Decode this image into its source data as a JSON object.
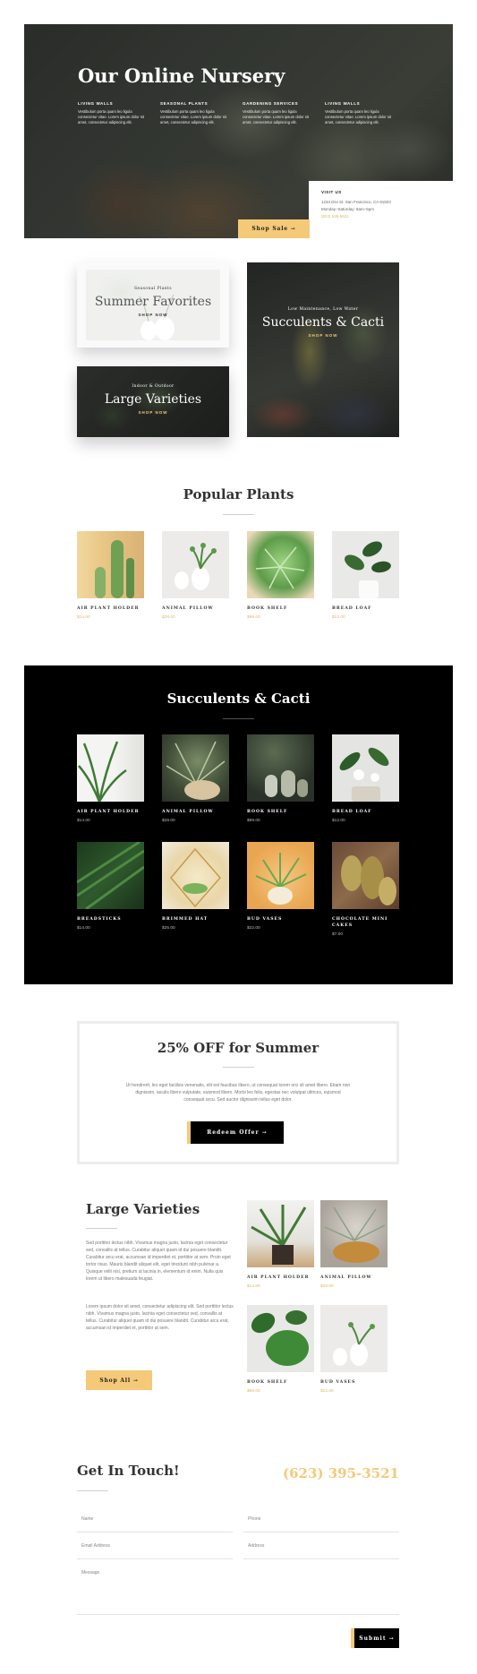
{
  "hero": {
    "title": "Our Online Nursery",
    "columns": [
      {
        "heading": "LIVING WALLS",
        "text": "Vestibulum porta quam leo ligula consectetur vitae. Lorem ipsum dolor sit amet, consectetur adipiscing elit."
      },
      {
        "heading": "SEASONAL PLANTS",
        "text": "Vestibulum porta quam leo ligula consectetur vitae. Lorem ipsum dolor sit amet, consectetur adipiscing elit."
      },
      {
        "heading": "GARDENING SERVICES",
        "text": "Vestibulum porta quam leo ligula consectetur vitae. Lorem ipsum dolor sit amet, consectetur adipiscing elit."
      },
      {
        "heading": "LIVING WALLS",
        "text": "Vestibulum porta quam leo ligula consectetur vitae. Lorem ipsum dolor sit amet, consectetur adipiscing elit."
      }
    ],
    "visit": {
      "heading": "VISIT US",
      "address": "1234 Divi St. San Francisco, CA 91823",
      "hours": "Monday–Saturday: 8am–5pm",
      "phone": "(623) 535-5621"
    },
    "button": "Shop Sale →"
  },
  "categories": {
    "summer": {
      "kicker": "Seasonal Plants",
      "name": "Summer Favorites",
      "cta": "SHOP NOW"
    },
    "large": {
      "kicker": "Indoor & Outdoor",
      "name": "Large Varieties",
      "cta": "SHOP NOW"
    },
    "succulents": {
      "kicker": "Low Maintenance, Low Water",
      "name": "Succulents & Cacti",
      "cta": "SHOP NOW"
    }
  },
  "popular": {
    "title": "Popular Plants",
    "items": [
      {
        "name": "AIR PLANT HOLDER",
        "price": "$14.00"
      },
      {
        "name": "ANIMAL PILLOW",
        "price": "$28.00"
      },
      {
        "name": "BOOK SHELF",
        "price": "$99.00"
      },
      {
        "name": "BREAD LOAF",
        "price": "$12.00"
      }
    ]
  },
  "succulents": {
    "title": "Succulents & Cacti",
    "items": [
      {
        "name": "AIR PLANT HOLDER",
        "price": "$14.00"
      },
      {
        "name": "ANIMAL PILLOW",
        "price": "$28.00"
      },
      {
        "name": "BOOK SHELF",
        "price": "$99.00"
      },
      {
        "name": "BREAD LOAF",
        "price": "$12.00"
      },
      {
        "name": "BREADSTICKS",
        "price": "$14.00"
      },
      {
        "name": "BRIMMED HAT",
        "price": "$25.00"
      },
      {
        "name": "BUD VASES",
        "price": "$22.00"
      },
      {
        "name": "CHOCOLATE MINI CAKES",
        "price": "$7.00"
      }
    ]
  },
  "promo": {
    "title": "25% OFF for Summer",
    "text": "Ut hendrerit, leo eget facilisis venenatis, elit est faucibus libero, ut consequat lorem orci sit amet libero. Etiam non dignissim, iaculis libero vulputate, euismod libero. Morbi leo felis, egestas nec volutpat ultrices, euismod consequat arcu. Sed auctor dignissim tellus eget dolor.",
    "button": "Redeem Offer →"
  },
  "large": {
    "title": "Large Varieties",
    "para1": "Sed porttitor lectus nibh. Vivamus magna justo, lacinia eget consectetur sed, convallis at tellus. Curabitur aliquet quam id dui posuere blandit. Curabitur arcu erat, accumsan id imperdiet et, porttitor at sem. Proin eget tortor risus. Mauris blandit aliquet elit, eget tincidunt nibh pulvinar a. Quisque velit nisi, pretium ut lacinia in, elementum id enim. Nulla quis lorem ut libero malesuada feugiat.",
    "para2": "Lorem ipsum dolor sit amet, consectetur adipiscing elit. Sed porttitor lectus nibh. Vivamus magna justo, lacinia eget consectetur sed, convallis at tellus. Curabitur aliquet quam id dui posuere blandit. Curabitur arcu erat, accumsan id imperdiet et, porttitor at sem.",
    "button": "Shop All →",
    "items": [
      {
        "name": "AIR PLANT HOLDER",
        "price": "$14.00"
      },
      {
        "name": "ANIMAL PILLOW",
        "price": "$28.00"
      },
      {
        "name": "BOOK SHELF",
        "price": "$99.00"
      },
      {
        "name": "BUD VASES",
        "price": "$22.00"
      }
    ]
  },
  "contact": {
    "title": "Get In Touch!",
    "phone": "(623) 395-3521",
    "fields": {
      "name": "Name",
      "phone": "Phone",
      "email": "Email Address",
      "address": "Address",
      "message": "Message"
    },
    "submit": "Submit →"
  },
  "colors": {
    "accent": "#f4c978",
    "dark": "#000000",
    "price": "#e0b860"
  }
}
